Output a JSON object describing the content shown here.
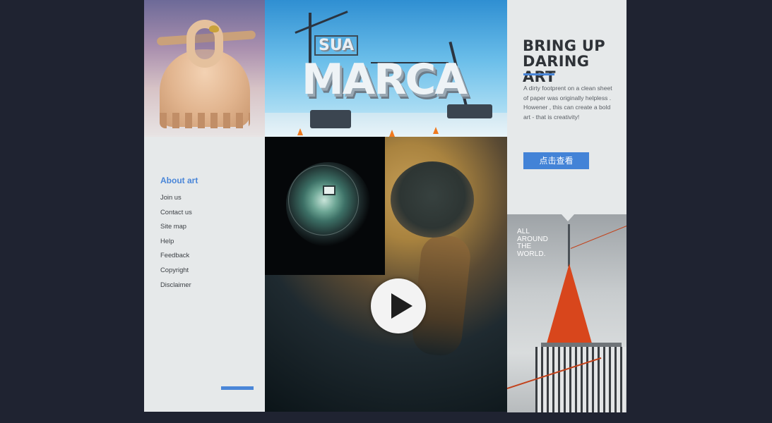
{
  "hero": {
    "title_line1": "BRING UP",
    "title_line2": "DARING ART",
    "description": "A dirty footprent on a clean sheet of paper was originally helpless . Howener , this can create a bold art - that is creativity!",
    "cta_label": "点击查看"
  },
  "construction_art": {
    "word_main": "MARCA",
    "word_small": "SUA"
  },
  "nav": {
    "heading": "About art",
    "items": [
      {
        "label": "Join us"
      },
      {
        "label": "Contact us"
      },
      {
        "label": "Site map"
      },
      {
        "label": "Help"
      },
      {
        "label": "Feedback"
      },
      {
        "label": "Copyright"
      },
      {
        "label": "Disclaimer"
      }
    ]
  },
  "tower_caption": {
    "line1": "ALL",
    "line2": "AROUND",
    "line3": "THE",
    "line4": "WORLD."
  },
  "colors": {
    "background": "#1f2331",
    "panel": "#e6e9ea",
    "accent": "#4383d7"
  },
  "icons": {
    "video": "play-icon"
  }
}
